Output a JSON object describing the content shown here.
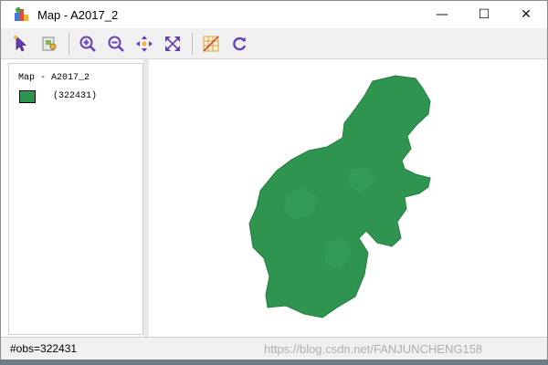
{
  "window": {
    "title": "Map - A2017_2",
    "minimize_glyph": "—",
    "maximize_glyph": "☐",
    "close_glyph": "✕"
  },
  "toolbar": {
    "items": [
      {
        "icon": "select-arrow-icon"
      },
      {
        "icon": "identify-icon"
      },
      {
        "icon": "zoom-in-icon"
      },
      {
        "icon": "zoom-out-icon"
      },
      {
        "icon": "pan-icon"
      },
      {
        "icon": "full-extent-icon"
      },
      {
        "icon": "grid-toggle-icon"
      },
      {
        "icon": "refresh-icon"
      }
    ]
  },
  "legend": {
    "title": "Map - A2017_2",
    "entries": [
      {
        "count": "(322431)",
        "color": "#2e9450"
      }
    ]
  },
  "map": {
    "fill_color": "#2e9450",
    "stroke_color": "#267d44"
  },
  "status": {
    "text": "#obs=322431",
    "watermark": "https://blog.csdn.net/FANJUNCHENG158"
  }
}
